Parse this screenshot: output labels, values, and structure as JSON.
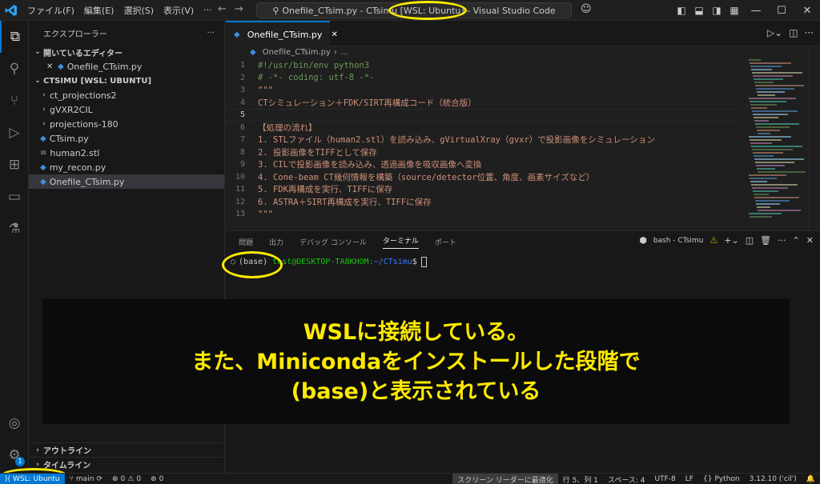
{
  "titlebar": {
    "menu": [
      "ファイル(F)",
      "編集(E)",
      "選択(S)",
      "表示(V)",
      "···"
    ],
    "command_center": "Onefile_CTsim.py - CTsimu [WSL: Ubuntu] - Visual Studio Code"
  },
  "sidebar": {
    "title": "エクスプローラー",
    "more": "···",
    "open_editors_label": "開いているエディター",
    "open_editors": [
      {
        "name": "Onefile_CTsim.py"
      }
    ],
    "workspace_label": "CTSIMU [WSL: UBUNTU]",
    "tree": [
      {
        "name": "ct_projections2",
        "type": "folder"
      },
      {
        "name": "gVXR2CIL",
        "type": "folder"
      },
      {
        "name": "projections-180",
        "type": "folder"
      },
      {
        "name": "CTsim.py",
        "type": "py"
      },
      {
        "name": "human2.stl",
        "type": "file"
      },
      {
        "name": "my_recon.py",
        "type": "py"
      },
      {
        "name": "Onefile_CTsim.py",
        "type": "py",
        "selected": true
      }
    ],
    "outline_label": "アウトライン",
    "timeline_label": "タイムライン"
  },
  "editor": {
    "tab_label": "Onefile_CTsim.py",
    "breadcrumb_file": "Onefile_CTsim.py",
    "breadcrumb_more": "...",
    "lines": [
      {
        "n": "1",
        "text": "#!/usr/bin/env python3",
        "kind": "cm"
      },
      {
        "n": "2",
        "text": "# -*- coding: utf-8 -*-",
        "kind": "cm"
      },
      {
        "n": "3",
        "text": "\"\"\"",
        "kind": "str"
      },
      {
        "n": "4",
        "text": "CTシミュレーション＋FDK/SIRT再構成コード（統合版）",
        "kind": "str"
      },
      {
        "n": "5",
        "text": "",
        "kind": "str"
      },
      {
        "n": "6",
        "text": "【処理の流れ】",
        "kind": "str"
      },
      {
        "n": "7",
        "text": "1. STLファイル（human2.stl）を読み込み、gVirtualXray（gvxr）で投影画像をシミュレーション",
        "kind": "str"
      },
      {
        "n": "8",
        "text": "2. 投影画像をTIFFとして保存",
        "kind": "str"
      },
      {
        "n": "9",
        "text": "3. CILで投影画像を読み込み、透過画像を吸収画像へ変換",
        "kind": "str"
      },
      {
        "n": "10",
        "text": "4. Cone-beam CT幾何情報を構築（source/detector位置、角度、画素サイズなど）",
        "kind": "str"
      },
      {
        "n": "11",
        "text": "5. FDK再構成を実行、TIFFに保存",
        "kind": "str"
      },
      {
        "n": "12",
        "text": "6. ASTRA＋SIRT再構成を実行、TIFFに保存",
        "kind": "str"
      },
      {
        "n": "13",
        "text": "\"\"\"",
        "kind": "str"
      }
    ]
  },
  "panel": {
    "tabs": [
      "問題",
      "出力",
      "デバッグ コンソール",
      "ターミナル",
      "ポート"
    ],
    "active_tab": "ターミナル",
    "terminal_name": "bash - CTsimu",
    "terminal": {
      "env": "(base)",
      "user_host": "test@DESKTOP-TA8KHOM",
      "path": ":~/CTsimu",
      "prompt": "$"
    }
  },
  "caption": {
    "line1": "WSLに接続している。",
    "line2": "また、Minicondaをインストールした段階で",
    "line3": "(base)と表示されている"
  },
  "statusbar": {
    "remote": "WSL: Ubuntu",
    "branch": "main",
    "errors": "0",
    "warnings": "0",
    "ports": "0",
    "screen_reader": "スクリーン リーダーに最適化",
    "position": "行 5、列 1",
    "spaces": "スペース: 4",
    "encoding": "UTF-8",
    "eol": "LF",
    "language": "Python",
    "interpreter": "3.12.10 ('cil')"
  },
  "colors": {
    "accent": "#0078d4",
    "highlight_ellipse": "#ffea00",
    "caption_text": "#ffea00"
  }
}
